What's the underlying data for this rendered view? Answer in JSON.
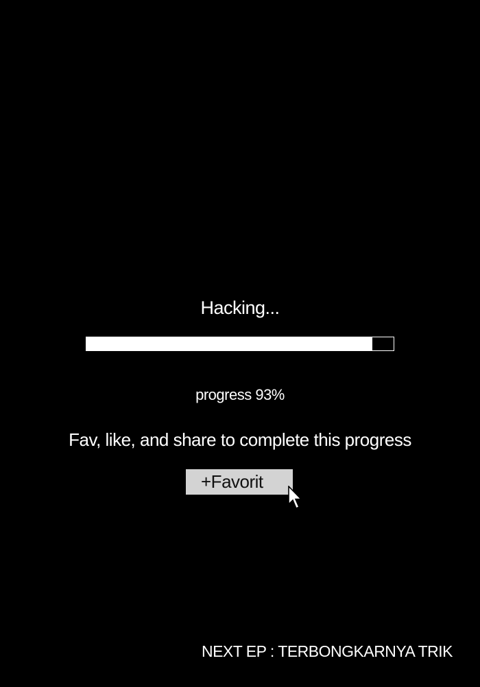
{
  "title": "Hacking...",
  "progress": {
    "value": 0.93,
    "label": "progress 93%"
  },
  "cta": {
    "text": "Fav, like, and share to complete this progress"
  },
  "favorite_button": {
    "label": "+Favorit"
  },
  "next_episode": {
    "text": "NEXT EP : TERBONGKARNYA TRIK"
  },
  "icons": {
    "cursor": "mouse-pointer-icon"
  },
  "colors": {
    "background": "#000000",
    "text": "#ffffff",
    "button_bg": "#d3d3d3",
    "button_text": "#111111"
  }
}
